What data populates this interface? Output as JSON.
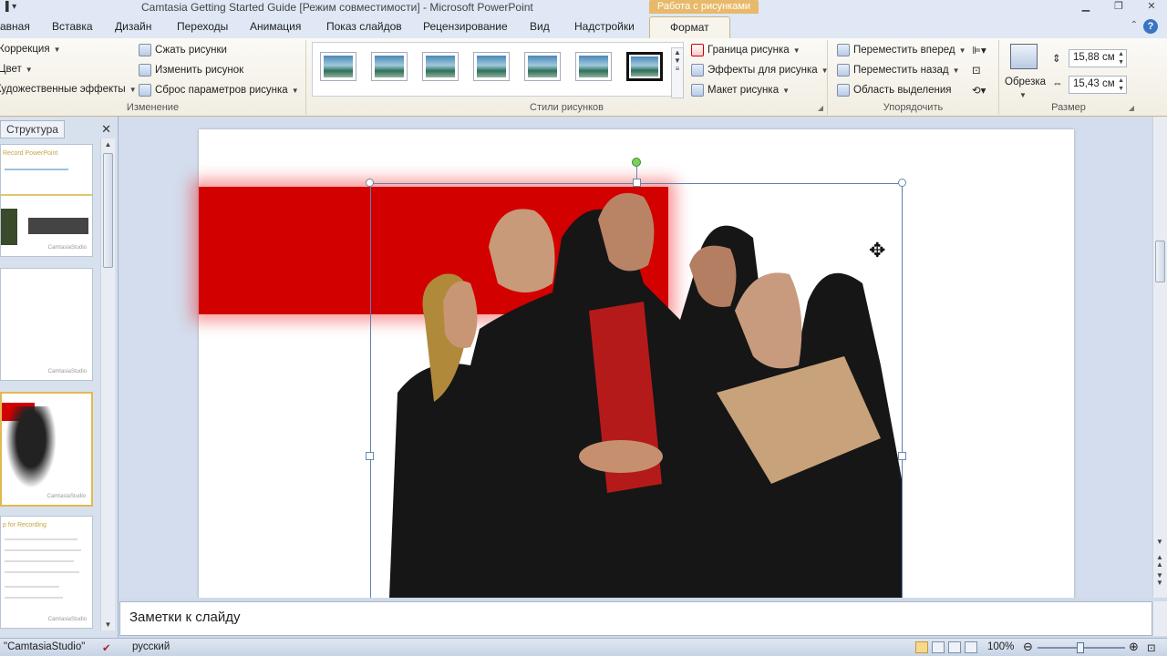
{
  "window": {
    "title": "Camtasia Getting Started Guide [Режим совместимости]  -  Microsoft PowerPoint",
    "context_tab_group": "Работа с рисунками"
  },
  "tabs": [
    {
      "label": "авная"
    },
    {
      "label": "Вставка"
    },
    {
      "label": "Дизайн"
    },
    {
      "label": "Переходы"
    },
    {
      "label": "Анимация"
    },
    {
      "label": "Показ слайдов"
    },
    {
      "label": "Рецензирование"
    },
    {
      "label": "Вид"
    },
    {
      "label": "Надстройки"
    },
    {
      "label": "Формат",
      "active": true
    }
  ],
  "ribbon": {
    "adjust": {
      "title": "Изменение",
      "correction": "Коррекция",
      "color": "Цвет",
      "artistic": "Художественные эффекты",
      "compress": "Сжать рисунки",
      "change": "Изменить рисунок",
      "reset": "Сброс параметров рисунка"
    },
    "styles": {
      "title": "Стили рисунков",
      "border": "Граница рисунка",
      "effects": "Эффекты для рисунка",
      "layout": "Макет рисунка"
    },
    "arrange": {
      "title": "Упорядочить",
      "forward": "Переместить вперед",
      "backward": "Переместить назад",
      "selection": "Область выделения"
    },
    "size": {
      "title": "Размер",
      "crop": "Обрезка",
      "height": "15,88 см",
      "width": "15,43 см"
    }
  },
  "left_panel": {
    "tab": "Структура",
    "slides": [
      {
        "caption": "Record PowerPoint",
        "brand": "CamtasiaStudio"
      },
      {
        "caption": "",
        "brand": "CamtasiaStudio"
      },
      {
        "caption": "",
        "brand": "CamtasiaStudio",
        "selected": true
      },
      {
        "caption": "p for Recording",
        "brand": "CamtasiaStudio"
      }
    ]
  },
  "notes": {
    "placeholder": "Заметки к слайду"
  },
  "status": {
    "theme": "\"CamtasiaStudio\"",
    "language": "русский",
    "zoom": "100%"
  },
  "colors": {
    "accent_red": "#d30000",
    "context_orange": "#e8b96a"
  }
}
